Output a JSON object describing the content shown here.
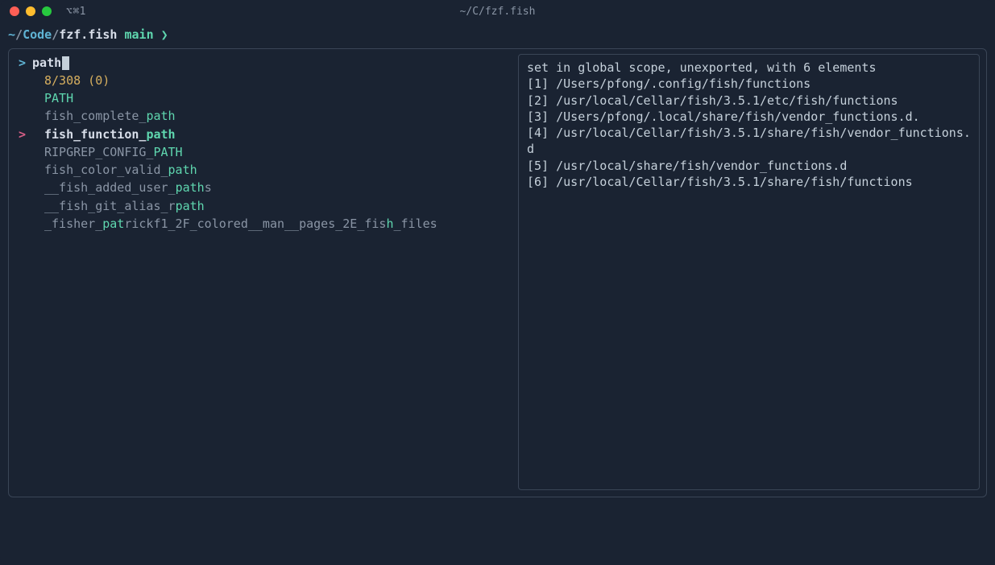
{
  "titlebar": {
    "tab_indicator": "⌥⌘1",
    "title": "~/C/fzf.fish"
  },
  "prompt": {
    "tilde": "~",
    "slash1": "/",
    "code": "Code",
    "slash2": "/",
    "fzf": "fzf.fish",
    "branch": "main",
    "arrow": "❯"
  },
  "fzf": {
    "query_marker": ">",
    "query": "path",
    "stats": "8/308 (0)",
    "items": [
      {
        "pointer": "",
        "segments": [
          {
            "t": "PATH",
            "c": "hl"
          }
        ]
      },
      {
        "pointer": "",
        "segments": [
          {
            "t": "fish_complete_",
            "c": "txt-normal"
          },
          {
            "t": "path",
            "c": "hl"
          }
        ]
      },
      {
        "pointer": ">",
        "selected": true,
        "segments": [
          {
            "t": "fish_function_",
            "c": "txt-sel"
          },
          {
            "t": "path",
            "c": "hlsel"
          }
        ]
      },
      {
        "pointer": "",
        "segments": [
          {
            "t": "RIPGREP_CONFIG_",
            "c": "txt-normal"
          },
          {
            "t": "PATH",
            "c": "hl"
          }
        ]
      },
      {
        "pointer": "",
        "segments": [
          {
            "t": "fish_color_valid_",
            "c": "txt-normal"
          },
          {
            "t": "path",
            "c": "hl"
          }
        ]
      },
      {
        "pointer": "",
        "segments": [
          {
            "t": "__fish_added_user_",
            "c": "txt-normal"
          },
          {
            "t": "path",
            "c": "hl"
          },
          {
            "t": "s",
            "c": "txt-normal"
          }
        ]
      },
      {
        "pointer": "",
        "segments": [
          {
            "t": "__fish_git_alias_r",
            "c": "txt-normal"
          },
          {
            "t": "path",
            "c": "hl"
          }
        ]
      },
      {
        "pointer": "",
        "segments": [
          {
            "t": "_fisher_",
            "c": "txt-normal"
          },
          {
            "t": "pat",
            "c": "hl"
          },
          {
            "t": "rickf1_2F_colored__man__pages_2E_fis",
            "c": "txt-normal"
          },
          {
            "t": "h",
            "c": "hl"
          },
          {
            "t": "_files",
            "c": "txt-normal"
          }
        ]
      }
    ]
  },
  "preview": {
    "lines": [
      "set in global scope, unexported, with 6 elements",
      "[1] /Users/pfong/.config/fish/functions",
      "[2] /usr/local/Cellar/fish/3.5.1/etc/fish/functions",
      "[3] /Users/pfong/.local/share/fish/vendor_functions.d.",
      "[4] /usr/local/Cellar/fish/3.5.1/share/fish/vendor_functions.d",
      "[5] /usr/local/share/fish/vendor_functions.d",
      "[6] /usr/local/Cellar/fish/3.5.1/share/fish/functions"
    ]
  }
}
